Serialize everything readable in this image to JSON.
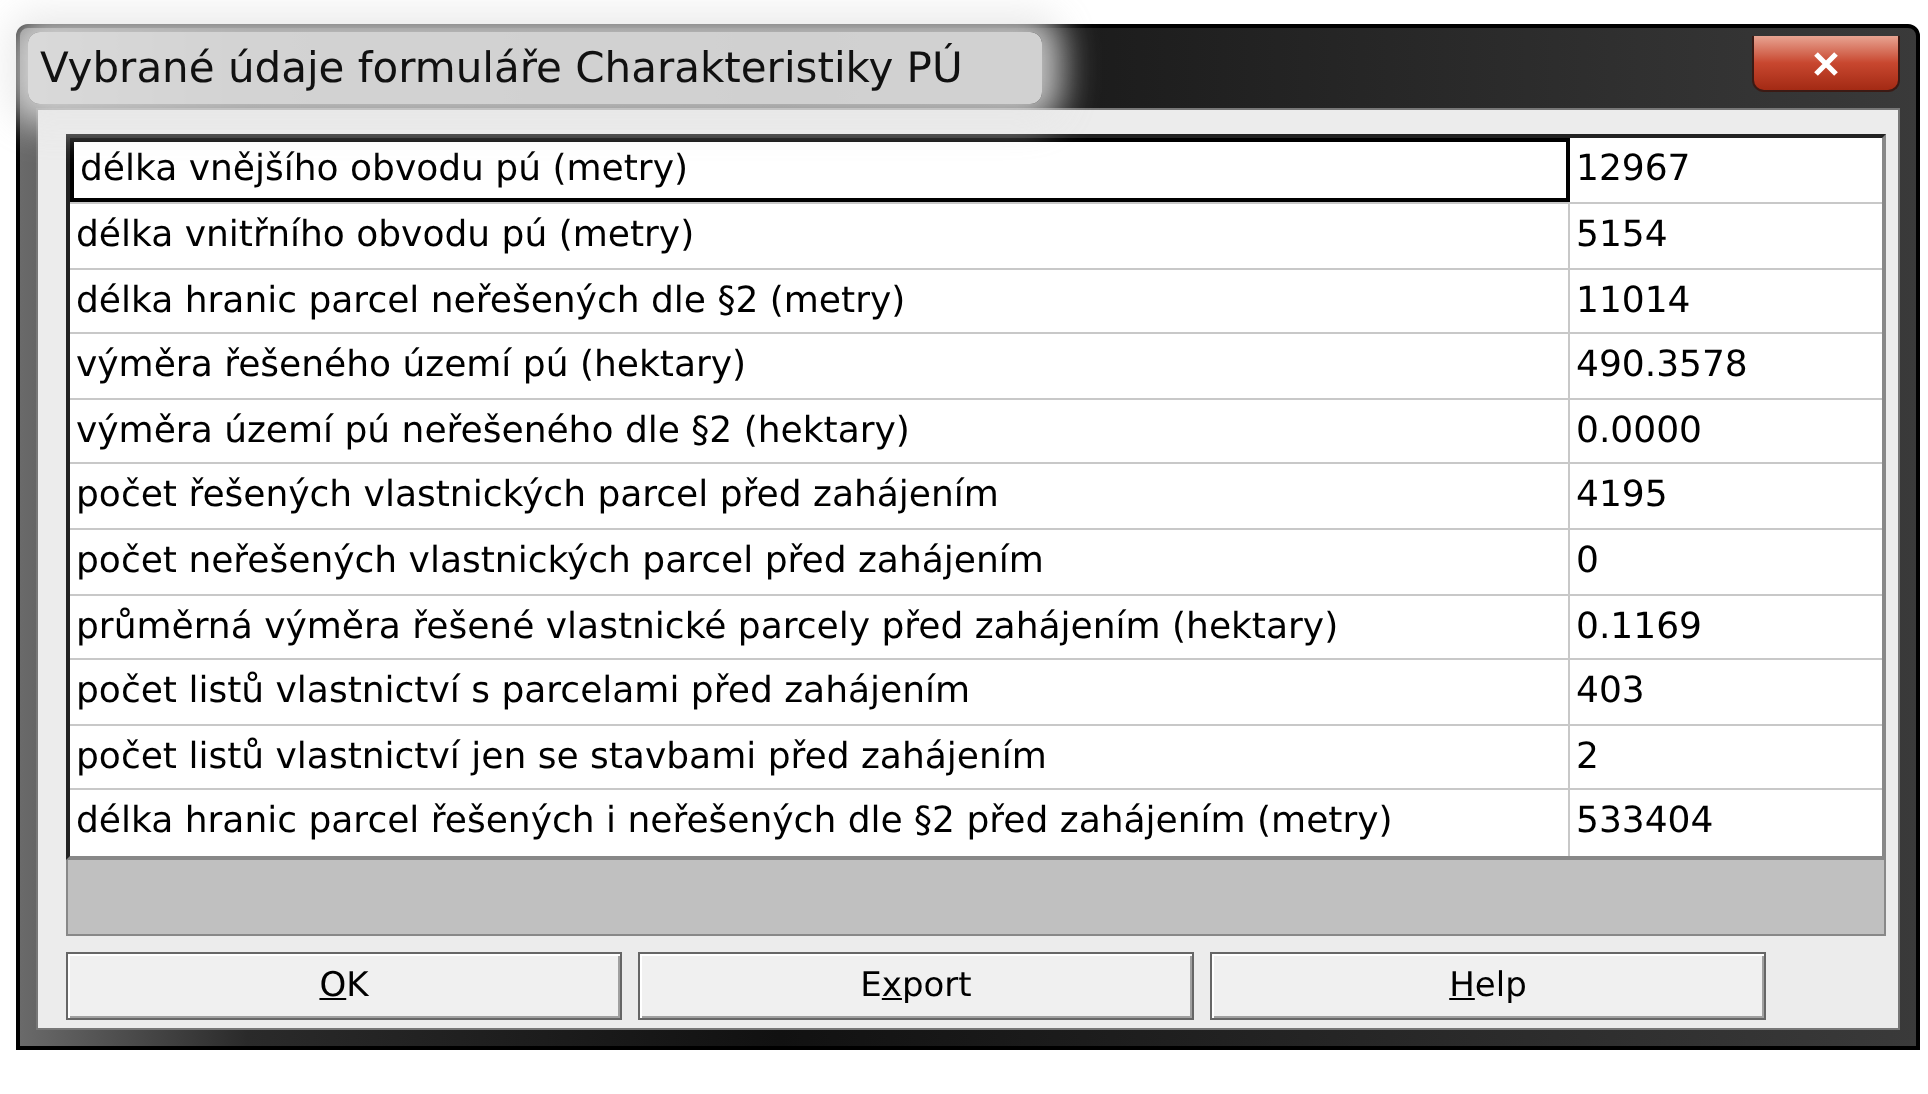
{
  "window": {
    "title": "Vybrané údaje formuláře Charakteristiky PÚ"
  },
  "table": {
    "rows": [
      {
        "label": "délka vnějšího obvodu pú (metry)",
        "value": "12967",
        "selected": true
      },
      {
        "label": "délka vnitřního obvodu pú (metry)",
        "value": "5154",
        "selected": false
      },
      {
        "label": "délka hranic parcel neřešených dle §2 (metry)",
        "value": "11014",
        "selected": false
      },
      {
        "label": "výměra řešeného území pú (hektary)",
        "value": "490.3578",
        "selected": false
      },
      {
        "label": "výměra území pú neřešeného dle §2 (hektary)",
        "value": "0.0000",
        "selected": false
      },
      {
        "label": "počet řešených vlastnických parcel před zahájením",
        "value": "4195",
        "selected": false
      },
      {
        "label": "počet neřešených vlastnických parcel před zahájením",
        "value": "0",
        "selected": false
      },
      {
        "label": "průměrná výměra řešené vlastnické parcely před zahájením (hektary)",
        "value": "0.1169",
        "selected": false
      },
      {
        "label": "počet listů vlastnictví s parcelami před zahájením",
        "value": "403",
        "selected": false
      },
      {
        "label": "počet listů vlastnictví jen se stavbami před zahájením",
        "value": "2",
        "selected": false
      },
      {
        "label": "délka hranic parcel řešených i neřešených dle §2 před zahájením (metry)",
        "value": "533404",
        "selected": false
      }
    ]
  },
  "buttons": [
    {
      "key": "O",
      "post": "K"
    },
    {
      "pre": "E",
      "key": "x",
      "post": "port"
    },
    {
      "key": "H",
      "post": "elp"
    }
  ]
}
